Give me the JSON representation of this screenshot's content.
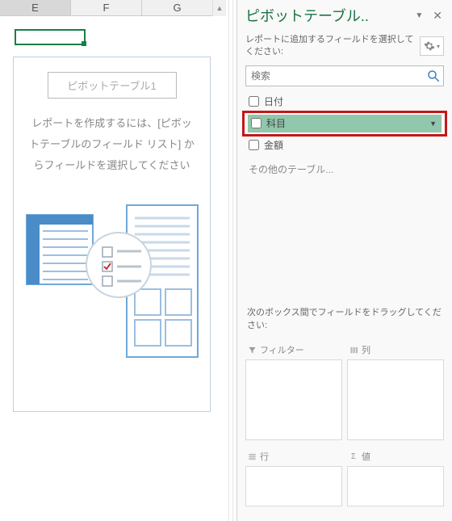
{
  "columns": [
    "E",
    "F",
    "G"
  ],
  "pivot_placeholder": {
    "title": "ピボットテーブル1",
    "message": "レポートを作成するには、[ピボットテーブルのフィールド リスト] からフィールドを選択してください"
  },
  "pane": {
    "title": "ピボットテーブル..",
    "sub_label": "レポートに追加するフィールドを選択してください:",
    "search_placeholder": "検索",
    "fields": {
      "f0": "日付",
      "f1": "科目",
      "f2": "金額"
    },
    "other_tables": "その他のテーブル...",
    "drag_label": "次のボックス間でフィールドをドラッグしてください:",
    "zones": {
      "filter": "フィルター",
      "cols": "列",
      "rows": "行",
      "vals": "値"
    }
  }
}
